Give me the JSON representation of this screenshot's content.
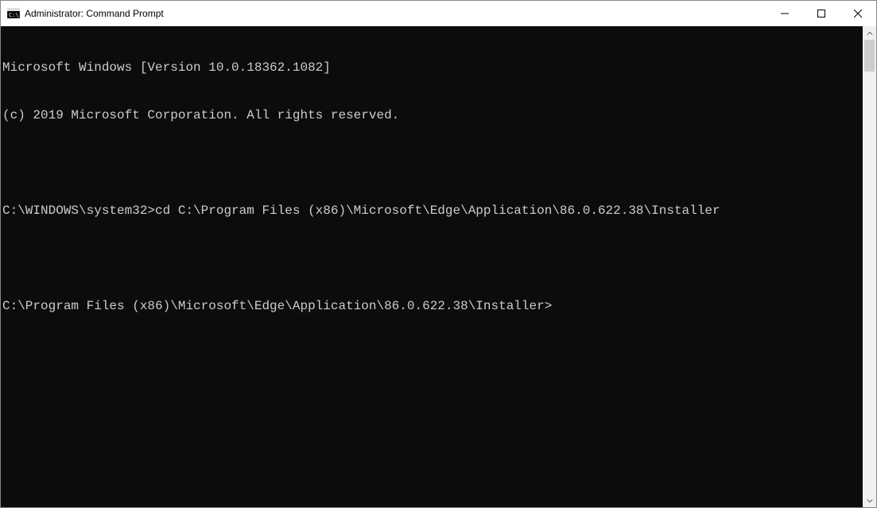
{
  "window": {
    "title": "Administrator: Command Prompt"
  },
  "terminal": {
    "lines": [
      "Microsoft Windows [Version 10.0.18362.1082]",
      "(c) 2019 Microsoft Corporation. All rights reserved.",
      "",
      "C:\\WINDOWS\\system32>cd C:\\Program Files (x86)\\Microsoft\\Edge\\Application\\86.0.622.38\\Installer",
      "",
      "C:\\Program Files (x86)\\Microsoft\\Edge\\Application\\86.0.622.38\\Installer>"
    ]
  }
}
